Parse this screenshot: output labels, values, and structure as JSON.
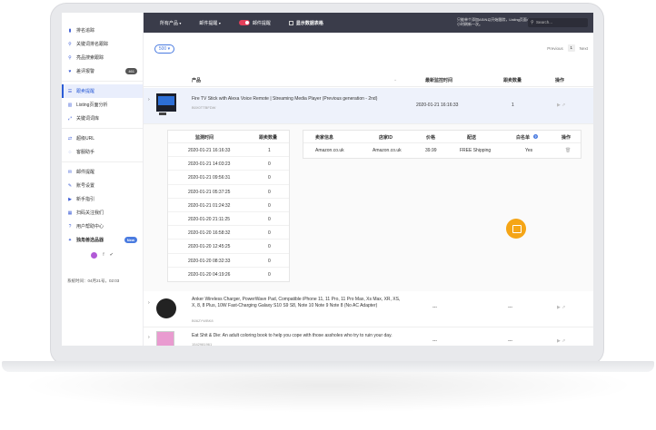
{
  "sidebar": {
    "items": [
      {
        "label": "排名追踪",
        "icon": "chart-bar-icon"
      },
      {
        "label": "关键词排名跟踪",
        "icon": "search-icon"
      },
      {
        "label": "亮品搜索跟踪",
        "icon": "search-icon"
      },
      {
        "label": "差评报警",
        "icon": "heart-icon",
        "badge": "461"
      },
      {
        "label": "跟卖提醒",
        "icon": "list-icon",
        "active": true
      },
      {
        "label": "Listing页面分析",
        "icon": "analysis-icon"
      },
      {
        "label": "关键词词库",
        "icon": "expand-icon"
      },
      {
        "label": "超级URL",
        "icon": "shuffle-icon"
      },
      {
        "label": "客服助手",
        "icon": "chat-icon"
      },
      {
        "label": "邮件提醒",
        "icon": "mail-icon"
      },
      {
        "label": "账号设置",
        "icon": "wrench-icon"
      },
      {
        "label": "新手指引",
        "icon": "video-icon"
      },
      {
        "label": "扫码关注我们",
        "icon": "qr-icon"
      },
      {
        "label": "用户帮助中心",
        "icon": "help-icon"
      },
      {
        "label": "独角兽选品器",
        "icon": "star-icon",
        "badge": "New",
        "bold": true
      }
    ],
    "system_time_label": "系统时间：04月21号，02:03"
  },
  "topbar": {
    "product_select": "所有产品",
    "status_select": "邮件提醒",
    "toggle_label": "邮件提醒",
    "checkbox_label": "显示数据表格",
    "note": "只能单个添加ASIN以开始跟踪，Listing页面4小时刷新一次。",
    "search_placeholder": "Search..."
  },
  "main": {
    "per_page": "500",
    "pager": {
      "prev": "Previous",
      "page": "1",
      "next": "Next"
    },
    "columns": {
      "product": "产品",
      "last_monitor": "最新监控时间",
      "follower_count": "跟卖数量",
      "action": "操作"
    },
    "rows": [
      {
        "title": "Fire TV Stick with Alexa Voice Remote | Streaming Media Player (Previous generation - 2nd)",
        "asin": "B0X0TTBFDW",
        "time": "2020-01-21 16:16:33",
        "count": "1"
      },
      {
        "title": "Anker Wireless Charger, PowerWave Pad, Compatible iPhone 11, 11 Pro, 11 Pro Max, Xs Max, XR, XS, X, 8, 8 Plus, 10W Fast-Charging Galaxy S10 S9 S8, Note 10 Note 9 Note 8 (No AC Adapter)",
        "asin": "B06ZYWBK8",
        "time": "---",
        "count": "---"
      },
      {
        "title": "Eat Shit & Die: An adult coloring book to help you cope with those assholes who try to ruin your day.",
        "asin": "1542981961",
        "time": "---",
        "count": "---"
      }
    ],
    "history": {
      "headers": {
        "time": "监测时间",
        "count": "跟卖数量"
      },
      "rows": [
        {
          "time": "2020-01-21 16:16:33",
          "count": "1"
        },
        {
          "time": "2020-01-21 14:03:23",
          "count": "0"
        },
        {
          "time": "2020-01-21 09:56:31",
          "count": "0"
        },
        {
          "time": "2020-01-21 05:37:25",
          "count": "0"
        },
        {
          "time": "2020-01-21 01:24:32",
          "count": "0"
        },
        {
          "time": "2020-01-20 21:11:25",
          "count": "0"
        },
        {
          "time": "2020-01-20 16:58:32",
          "count": "0"
        },
        {
          "time": "2020-01-20 12:45:25",
          "count": "0"
        },
        {
          "time": "2020-01-20 08:32:33",
          "count": "0"
        },
        {
          "time": "2020-01-20 04:19:26",
          "count": "0"
        }
      ]
    },
    "sellers": {
      "headers": {
        "seller": "卖家信息",
        "seller_id": "店家ID",
        "price": "价格",
        "shipping": "配送",
        "whitelist": "白名单",
        "action": "操作"
      },
      "rows": [
        {
          "seller": "Amazon.co.uk",
          "seller_id": "Amazon.co.uk",
          "price": "39.99",
          "shipping": "FREE Shipping",
          "whitelist": "Yes"
        }
      ]
    }
  },
  "colors": {
    "topbar": "#3a3c4a",
    "accent": "#2b5cd6",
    "toggle": "#e43f5a",
    "chat": "#f5a516"
  }
}
